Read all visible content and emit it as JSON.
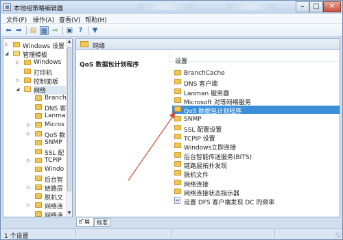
{
  "title_bar": {
    "title": "本地组策略编辑器",
    "min": "–",
    "max": "□",
    "close": "✕"
  },
  "menu": [
    "文件(F)",
    "操作(A)",
    "查看(V)",
    "帮助(H)"
  ],
  "toolbar_icons": [
    "back-arrow-icon",
    "forward-arrow-icon",
    "folder-up-icon",
    "show-hide-tree-icon",
    "export-list-icon",
    "properties-icon",
    "help-icon",
    "filter-icon"
  ],
  "tree": [
    {
      "label": "Windows 设置",
      "expander": "▷",
      "open": false,
      "selected": false
    },
    {
      "label": "管理模板",
      "expander": "◢",
      "open": true,
      "selected": false
    },
    {
      "label": "Windows",
      "expander": "▷",
      "open": false,
      "selected": false
    },
    {
      "label": "打印机",
      "expander": "",
      "open": false,
      "selected": false
    },
    {
      "label": "控制面板",
      "expander": "▷",
      "open": false,
      "selected": false
    },
    {
      "label": "网络",
      "expander": "◢",
      "open": true,
      "selected": true
    },
    {
      "label": "BranchC",
      "expander": "",
      "open": false,
      "selected": false
    },
    {
      "label": "DNS 客",
      "expander": "",
      "open": false,
      "selected": false
    },
    {
      "label": "Lanmai",
      "expander": "",
      "open": false,
      "selected": false
    },
    {
      "label": "Micros",
      "expander": "▷",
      "open": false,
      "selected": false
    },
    {
      "label": "QoS 数",
      "expander": "▷",
      "open": false,
      "selected": false
    },
    {
      "label": "SNMP",
      "expander": "",
      "open": false,
      "selected": false
    },
    {
      "label": "SSL 配",
      "expander": "",
      "open": false,
      "selected": false
    },
    {
      "label": "TCPIP",
      "expander": "▷",
      "open": false,
      "selected": false
    },
    {
      "label": "Windo",
      "expander": "",
      "open": false,
      "selected": false
    },
    {
      "label": "后台智",
      "expander": "",
      "open": false,
      "selected": false
    },
    {
      "label": "链路层",
      "expander": "▷",
      "open": false,
      "selected": false
    },
    {
      "label": "脱机文",
      "expander": "",
      "open": false,
      "selected": false
    },
    {
      "label": "网络连",
      "expander": "▷",
      "open": false,
      "selected": false
    },
    {
      "label": "网络连",
      "expander": "",
      "open": false,
      "selected": false
    }
  ],
  "right_pane": {
    "header": "网络",
    "description_title": "QoS 数据包计划程序",
    "list_header": "设置",
    "items": [
      {
        "label": "BranchCache",
        "type": "folder",
        "selected": false
      },
      {
        "label": "DNS 客户端",
        "type": "folder",
        "selected": false
      },
      {
        "label": "Lanman 服务器",
        "type": "folder",
        "selected": false
      },
      {
        "label": "Microsoft 对等网络服务",
        "type": "folder",
        "selected": false
      },
      {
        "label": "QoS 数据包计划程序",
        "type": "folder",
        "selected": true
      },
      {
        "label": "SNMP",
        "type": "folder",
        "selected": false
      },
      {
        "label": "SSL 配置设置",
        "type": "folder",
        "selected": false
      },
      {
        "label": "TCPIP 设置",
        "type": "folder",
        "selected": false
      },
      {
        "label": "Windows立即连接",
        "type": "folder",
        "selected": false
      },
      {
        "label": "后台智能传送服务(BITS)",
        "type": "folder",
        "selected": false
      },
      {
        "label": "链路层拓扑发现",
        "type": "folder",
        "selected": false
      },
      {
        "label": "脱机文件",
        "type": "folder",
        "selected": false
      },
      {
        "label": "网络连接",
        "type": "folder",
        "selected": false
      },
      {
        "label": "网络连接状态指示器",
        "type": "folder",
        "selected": false
      },
      {
        "label": "设置 DFS 客户端发现 DC 的频率",
        "type": "setting",
        "selected": false
      }
    ]
  },
  "tabs": [
    "扩展",
    "标准"
  ],
  "status": {
    "text": "1 个设置"
  },
  "colors": {
    "selection": "#3b8fd9",
    "annotation_arrow": "#d04a3a"
  }
}
